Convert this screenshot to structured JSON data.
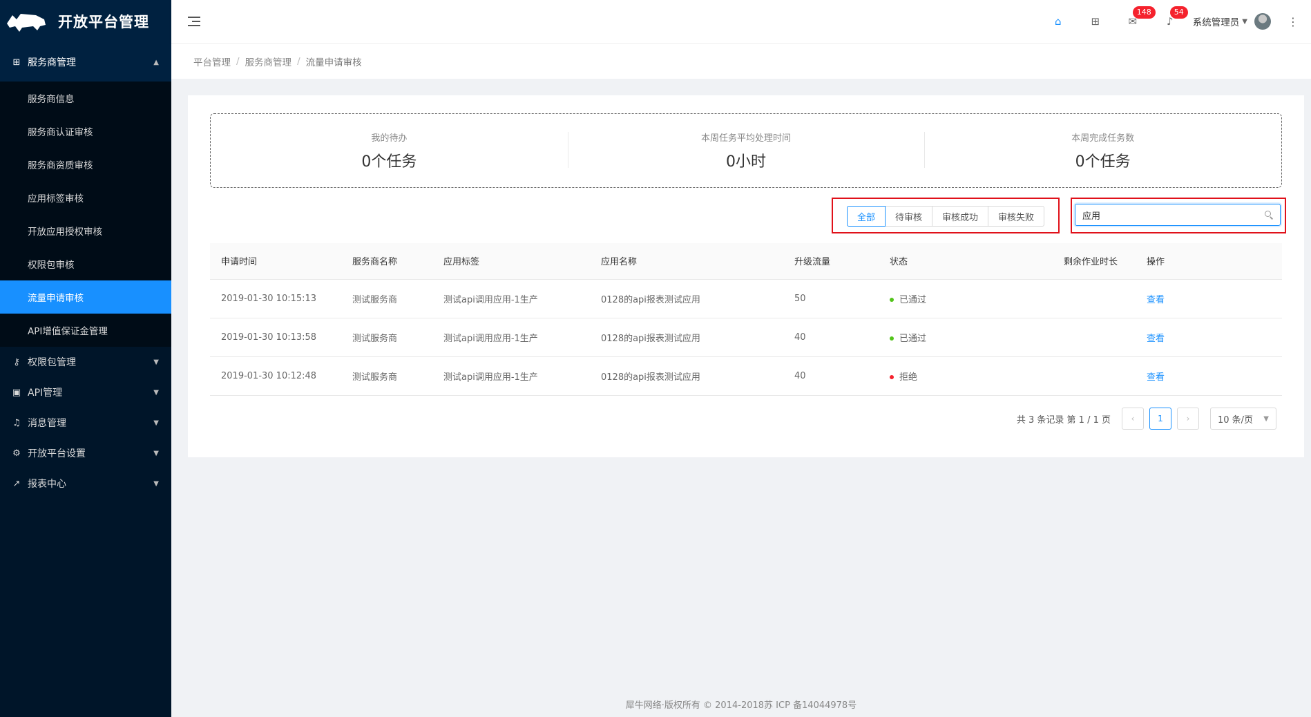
{
  "app": {
    "title": "开放平台管理"
  },
  "sidebar": {
    "group": {
      "label": "服务商管理"
    },
    "sub_items": [
      {
        "label": "服务商信息"
      },
      {
        "label": "服务商认证审核"
      },
      {
        "label": "服务商资质审核"
      },
      {
        "label": "应用标签审核"
      },
      {
        "label": "开放应用授权审核"
      },
      {
        "label": "权限包审核"
      },
      {
        "label": "流量申请审核"
      },
      {
        "label": "API增值保证金管理"
      }
    ],
    "items": [
      {
        "label": "权限包管理"
      },
      {
        "label": "API管理"
      },
      {
        "label": "消息管理"
      },
      {
        "label": "开放平台设置"
      },
      {
        "label": "报表中心"
      }
    ]
  },
  "header": {
    "mail_badge": "148",
    "bell_badge": "54",
    "user_name": "系统管理员"
  },
  "breadcrumb": [
    "平台管理",
    "服务商管理",
    "流量申请审核"
  ],
  "stats": [
    {
      "label": "我的待办",
      "value": "0个任务"
    },
    {
      "label": "本周任务平均处理时间",
      "value": "0小时"
    },
    {
      "label": "本周完成任务数",
      "value": "0个任务"
    }
  ],
  "filters": [
    "全部",
    "待审核",
    "审核成功",
    "审核失败"
  ],
  "search": {
    "value": "应用"
  },
  "table": {
    "columns": [
      "申请时间",
      "服务商名称",
      "应用标签",
      "应用名称",
      "升级流量",
      "状态",
      "剩余作业时长",
      "操作"
    ],
    "rows": [
      {
        "time": "2019-01-30 10:15:13",
        "provider": "测试服务商",
        "tag": "测试api调用应用-1生产",
        "app": "0128的api报表测试应用",
        "traffic": "50",
        "status": "已通过",
        "status_color": "#52c41a",
        "remaining": "",
        "action": "查看"
      },
      {
        "time": "2019-01-30 10:13:58",
        "provider": "测试服务商",
        "tag": "测试api调用应用-1生产",
        "app": "0128的api报表测试应用",
        "traffic": "40",
        "status": "已通过",
        "status_color": "#52c41a",
        "remaining": "",
        "action": "查看"
      },
      {
        "time": "2019-01-30 10:12:48",
        "provider": "测试服务商",
        "tag": "测试api调用应用-1生产",
        "app": "0128的api报表测试应用",
        "traffic": "40",
        "status": "拒绝",
        "status_color": "#f5222d",
        "remaining": "",
        "action": "查看"
      }
    ]
  },
  "pagination": {
    "info": "共 3 条记录 第 1 / 1 页",
    "current": "1",
    "page_size": "10 条/页"
  },
  "footer": {
    "text": "犀牛网络·版权所有 © 2014-2018苏 ICP 备14044978号"
  },
  "colors": {
    "primary": "#1890ff",
    "sidebar_bg": "#001529",
    "highlight_border": "#e0111a"
  }
}
